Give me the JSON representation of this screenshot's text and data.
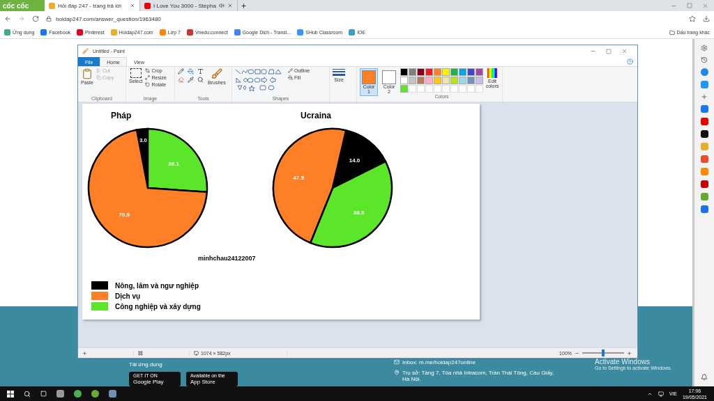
{
  "browser": {
    "brand": "cốc cốc",
    "tabs": [
      {
        "title": "Hỏi đáp 247 - trang trả lời",
        "selected": true
      },
      {
        "title": "I Love You 3000 - Stepha",
        "selected": false
      }
    ],
    "address": "hoidap247.com/answer_question/1963480",
    "bookmarks": [
      "Ứng dụng",
      "Facebook",
      "Pinterest",
      "Hoidap247.com",
      "Lớp 7",
      "Vnedu.connect",
      "Google Dịch - Transl...",
      "SHub Classroom",
      "IOE"
    ],
    "other_bookmarks": "Dấu trang khác"
  },
  "page": {
    "app_label": "Tải ứng dụng",
    "store_buttons": [
      {
        "small": "GET IT ON",
        "big": "Google Play"
      },
      {
        "small": "Available on the",
        "big": "App Store"
      }
    ],
    "inbox": "Inbox: m.me/hoidap247online",
    "office": "Trụ sở: Tầng 7, Tòa nhà Intracom, Trần Thái Tông, Cầu Giấy, Hà Nội."
  },
  "paint": {
    "title": "Untitled - Paint",
    "tabs": [
      {
        "label": "File",
        "kind": "file",
        "selected": false
      },
      {
        "label": "Home",
        "kind": "tab",
        "selected": true
      },
      {
        "label": "View",
        "kind": "tab",
        "selected": false
      }
    ],
    "clipboard": {
      "label": "Clipboard",
      "paste": "Paste",
      "items": [
        {
          "label": "Cut",
          "disabled": true
        },
        {
          "label": "Copy",
          "disabled": true
        }
      ]
    },
    "image": {
      "label": "Image",
      "select": "Select",
      "items": [
        {
          "label": "Crop",
          "disabled": false
        },
        {
          "label": "Resize",
          "disabled": false
        },
        {
          "label": "Rotate",
          "disabled": false
        }
      ]
    },
    "tools": {
      "label": "Tools",
      "brushes": "Brushes"
    },
    "shapes": {
      "label": "Shapes",
      "outline": "Outline",
      "fill": "Fill"
    },
    "size": "Size",
    "color_slots": [
      {
        "label": "Color 1",
        "color": "#ff7f27",
        "selected": true
      },
      {
        "label": "Color 2",
        "color": "#ffffff",
        "selected": false
      }
    ],
    "palette": [
      {
        "color": "#000000"
      },
      {
        "color": "#7f7f7f"
      },
      {
        "color": "#880015"
      },
      {
        "color": "#ed1c24"
      },
      {
        "color": "#ff7f27"
      },
      {
        "color": "#fff200"
      },
      {
        "color": "#22b14c"
      },
      {
        "color": "#00a2e8"
      },
      {
        "color": "#3f48cc"
      },
      {
        "color": "#a349a4"
      },
      {
        "color": "#ffffff"
      },
      {
        "color": "#c3c3c3"
      },
      {
        "color": "#b97a57"
      },
      {
        "color": "#ffaec9"
      },
      {
        "color": "#ffc90e"
      },
      {
        "color": "#efe4b0"
      },
      {
        "color": "#b5e61d"
      },
      {
        "color": "#99d9ea"
      },
      {
        "color": "#7092be"
      },
      {
        "color": "#c8bfe7"
      },
      {
        "color": "#5ce62a"
      }
    ],
    "edit_colors": "Edit colors",
    "colors_label": "Colors",
    "canvas": {
      "charts": [
        {
          "chart_data": {
            "type": "pie",
            "title": "Pháp",
            "values": [
              3.0,
              26.1,
              70.9
            ],
            "value_labels": [
              "3.0",
              "26.1",
              "70.9"
            ],
            "colors": [
              "#000000",
              "#5ce62a",
              "#ff7f27"
            ],
            "data_labels": true
          }
        },
        {
          "chart_data": {
            "type": "pie",
            "title": "Ucraina",
            "values": [
              14.0,
              38.5,
              47.5
            ],
            "value_labels": [
              "14.0",
              "38.5",
              "47.5"
            ],
            "colors": [
              "#000000",
              "#5ce62a",
              "#ff7f27"
            ],
            "data_labels": true
          }
        }
      ],
      "signature": "minhchau24122007",
      "legend": [
        {
          "label": "Nông, lâm và ngư nghiệp",
          "color": "#000000"
        },
        {
          "label": "Dịch vụ",
          "color": "#ff7f27"
        },
        {
          "label": "Công nghiệp và xây dựng",
          "color": "#5ce62a"
        }
      ]
    },
    "status": {
      "dimensions": "1074 × 582px",
      "zoom": "100%",
      "level": 0.5
    }
  },
  "activation": {
    "title": "Activate Windows",
    "subtitle": "Go to Settings to activate Windows."
  },
  "taskbar": {
    "language": "VIE",
    "time": "17:06",
    "date": "19/05/2021"
  }
}
